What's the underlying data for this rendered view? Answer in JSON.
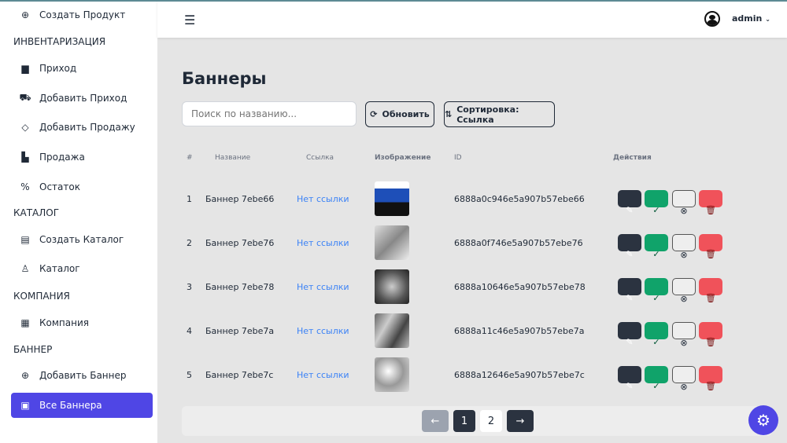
{
  "sidebar": {
    "items": [
      {
        "label": "Создать Продукт",
        "icon": "plus-circle-icon"
      },
      {
        "label": "Приход",
        "icon": "warehouse-icon"
      },
      {
        "label": "Добавить Приход",
        "icon": "truck-icon"
      },
      {
        "label": "Добавить Продажу",
        "icon": "tag-icon"
      },
      {
        "label": "Продажа",
        "icon": "cash-register-icon"
      },
      {
        "label": "Остаток",
        "icon": "percent-icon"
      },
      {
        "label": "Создать Каталог",
        "icon": "catalog-add-icon"
      },
      {
        "label": "Каталог",
        "icon": "catalog-icon"
      },
      {
        "label": "Компания",
        "icon": "building-icon"
      },
      {
        "label": "Добавить Баннер",
        "icon": "plus-circle-icon"
      },
      {
        "label": "Все Баннера",
        "icon": "image-icon"
      }
    ],
    "sections": [
      "ИНВЕНТАРИЗАЦИЯ",
      "КАТАЛОГ",
      "КОМПАНИЯ",
      "БАННЕР"
    ]
  },
  "header": {
    "user": "admin"
  },
  "page": {
    "title": "Баннеры",
    "search_placeholder": "Поиск по названию...",
    "refresh": "Обновить",
    "sort": "Сортировка: Ссылка"
  },
  "table": {
    "headers": [
      "#",
      "Название",
      "Ссылка",
      "Изображение",
      "ID",
      "Действия"
    ],
    "rows": [
      {
        "n": "1",
        "name": "Баннер 7ebe66",
        "link": "Нет ссылки",
        "id": "6888a0c946e5a907b57ebe66"
      },
      {
        "n": "2",
        "name": "Баннер 7ebe76",
        "link": "Нет ссылки",
        "id": "6888a0f746e5a907b57ebe76"
      },
      {
        "n": "3",
        "name": "Баннер 7ebe78",
        "link": "Нет ссылки",
        "id": "6888a10646e5a907b57ebe78"
      },
      {
        "n": "4",
        "name": "Баннер 7ebe7a",
        "link": "Нет ссылки",
        "id": "6888a11c46e5a907b57ebe7a"
      },
      {
        "n": "5",
        "name": "Баннер 7ebe7c",
        "link": "Нет ссылки",
        "id": "6888a12646e5a907b57ebe7c"
      }
    ]
  },
  "pagination": {
    "prev": "←",
    "pages": [
      "1",
      "2"
    ],
    "next": "→",
    "current": "1"
  },
  "colors": {
    "accent": "#4f46e5",
    "dark": "#2b3340",
    "green": "#10a36a",
    "red": "#f0525a"
  }
}
